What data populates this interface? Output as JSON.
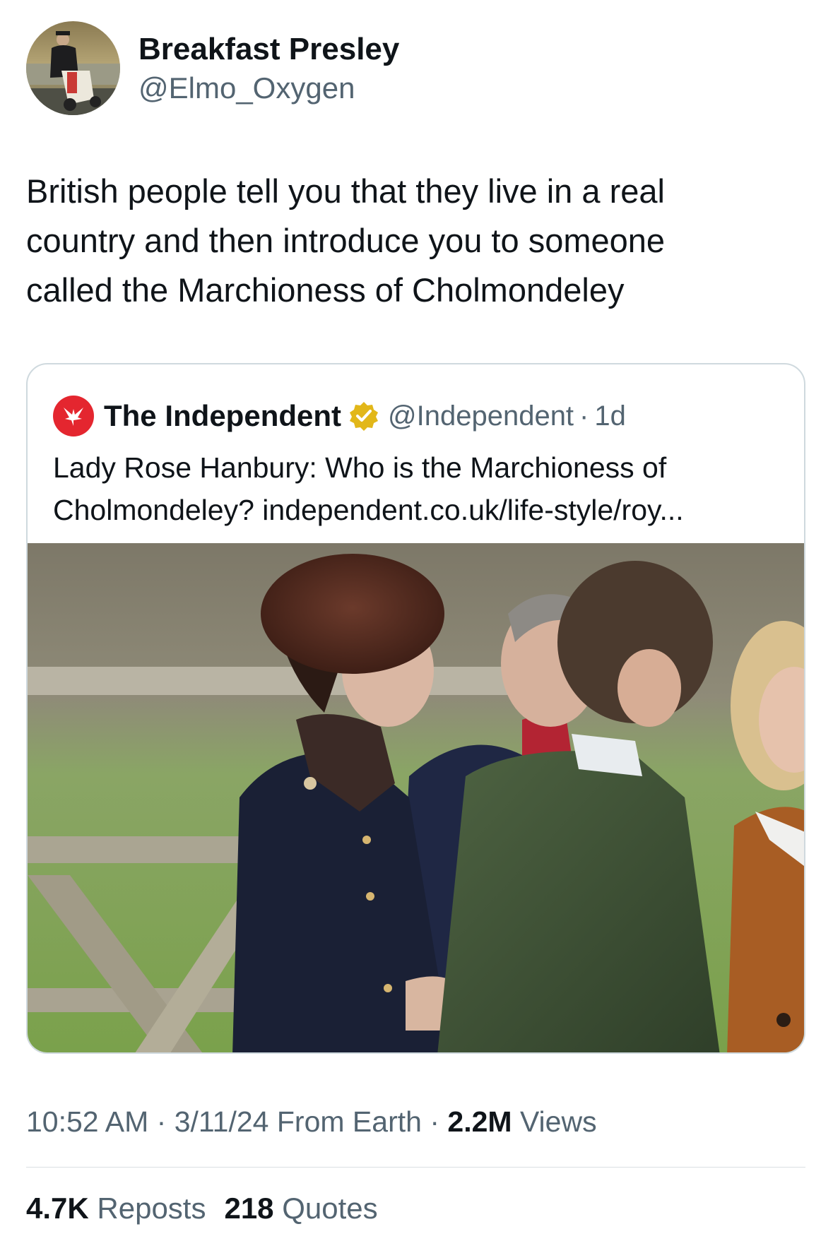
{
  "author": {
    "display_name": "Breakfast Presley",
    "handle": "@Elmo_Oxygen",
    "avatar_icon": "avatar-man-on-scooter"
  },
  "tweet": {
    "text": "British people tell you that they live in a real\ncountry and then introduce you to someone\ncalled the Marchioness of Cholmondeley"
  },
  "quoted": {
    "name": "The Independent",
    "handle": "@Independent",
    "separator": "·",
    "time": "1d",
    "verified_icon": "gold-verified-badge-icon",
    "logo_icon": "independent-eagle-logo",
    "text_line1": "Lady Rose Hanbury: Who is the Marchioness of",
    "text_line2": "Cholmondeley? independent.co.uk/life-style/roy...",
    "image_icon": "photo-woman-in-fur-hat-with-group"
  },
  "meta": {
    "time": "10:52 AM",
    "sep1": "·",
    "date": "3/11/24",
    "source": "From Earth",
    "sep2": "·",
    "views_count": "2.2M",
    "views_label": "Views"
  },
  "stats": {
    "reposts_count": "4.7K",
    "reposts_label": "Reposts",
    "quotes_count": "218",
    "quotes_label": "Quotes"
  },
  "colors": {
    "text": "#0f1419",
    "secondary": "#536471",
    "border": "#cfd9de",
    "brand_red": "#e4262f",
    "verified_gold": "#e2b719"
  }
}
